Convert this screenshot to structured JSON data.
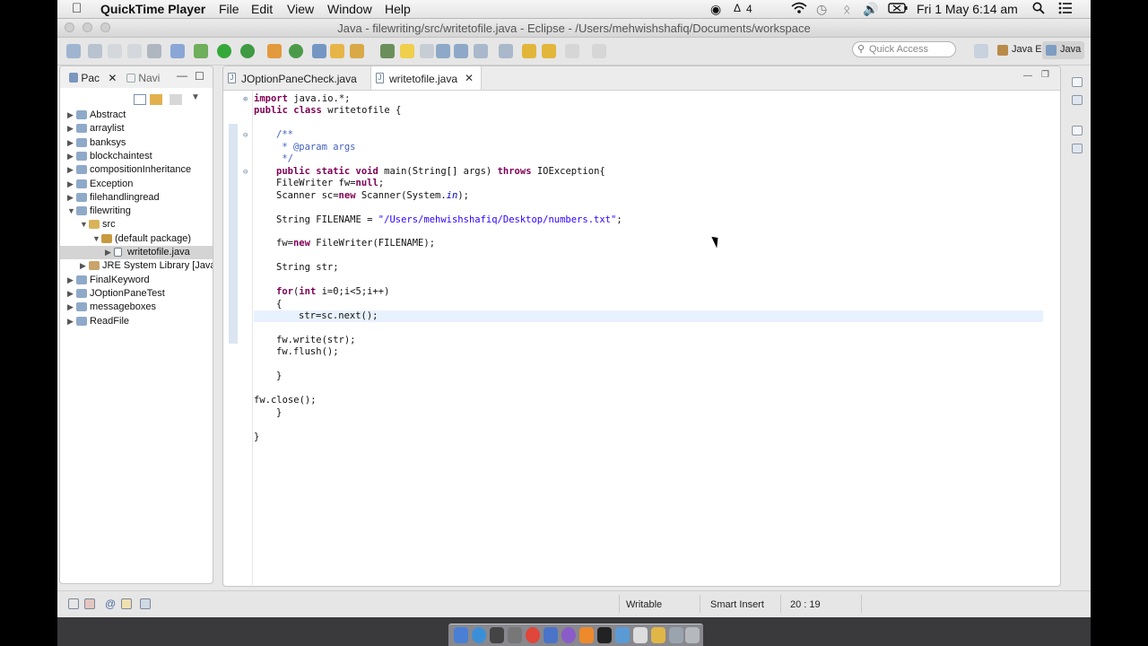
{
  "menubar": {
    "app_name": "QuickTime Player",
    "items": [
      "File",
      "Edit",
      "View",
      "Window",
      "Help"
    ],
    "status_icons": [
      "record-icon",
      "adobe-icon",
      "wifi-icon",
      "time-machine-icon",
      "bluetooth-icon",
      "volume-icon",
      "battery-icon",
      "spotlight-icon",
      "notification-center-icon"
    ],
    "badge": "4",
    "clock": "Fri 1 May  6:14 am"
  },
  "window": {
    "title": "Java - filewriting/src/writetofile.java - Eclipse - /Users/mehwishshafiq/Documents/workspace"
  },
  "toolbar": {
    "quick_access_placeholder": "Quick Access",
    "perspectives": [
      "Java EE",
      "Java"
    ]
  },
  "explorer": {
    "tabs": [
      "Pac",
      "Navi"
    ],
    "items": [
      {
        "label": "Abstract",
        "depth": 0,
        "expanded": false,
        "kind": "project"
      },
      {
        "label": "arraylist",
        "depth": 0,
        "expanded": false,
        "kind": "project"
      },
      {
        "label": "banksys",
        "depth": 0,
        "expanded": false,
        "kind": "project"
      },
      {
        "label": "blockchaintest",
        "depth": 0,
        "expanded": false,
        "kind": "project"
      },
      {
        "label": "compositionInheritance",
        "depth": 0,
        "expanded": false,
        "kind": "project"
      },
      {
        "label": "Exception",
        "depth": 0,
        "expanded": false,
        "kind": "project"
      },
      {
        "label": "filehandlingread",
        "depth": 0,
        "expanded": false,
        "kind": "project"
      },
      {
        "label": "filewriting",
        "depth": 0,
        "expanded": true,
        "kind": "project"
      },
      {
        "label": "src",
        "depth": 1,
        "expanded": true,
        "kind": "src"
      },
      {
        "label": "(default package)",
        "depth": 2,
        "expanded": true,
        "kind": "package"
      },
      {
        "label": "writetofile.java",
        "depth": 3,
        "expanded": false,
        "kind": "java",
        "selected": true
      },
      {
        "label": "JRE System Library [Java",
        "depth": 1,
        "expanded": false,
        "kind": "library"
      },
      {
        "label": "FinalKeyword",
        "depth": 0,
        "expanded": false,
        "kind": "project"
      },
      {
        "label": "JOptionPaneTest",
        "depth": 0,
        "expanded": false,
        "kind": "project"
      },
      {
        "label": "messageboxes",
        "depth": 0,
        "expanded": false,
        "kind": "project"
      },
      {
        "label": "ReadFile",
        "depth": 0,
        "expanded": false,
        "kind": "project"
      }
    ]
  },
  "editor": {
    "tabs": [
      {
        "label": "JOptionPaneCheck.java",
        "active": false
      },
      {
        "label": "writetofile.java",
        "active": true
      }
    ],
    "lines": [
      {
        "indent": 0,
        "parts": [
          [
            "kw",
            "import"
          ],
          [
            "",
            " java.io.*;"
          ]
        ],
        "fold": "plus"
      },
      {
        "indent": 0,
        "parts": [
          [
            "kw",
            "public"
          ],
          [
            "",
            " "
          ],
          [
            "kw",
            "class"
          ],
          [
            "",
            " writetofile {"
          ]
        ]
      },
      {
        "indent": 0,
        "parts": []
      },
      {
        "indent": 1,
        "parts": [
          [
            "cm",
            "/**"
          ]
        ],
        "fold": "minus"
      },
      {
        "indent": 1,
        "parts": [
          [
            "cm",
            " * @param args"
          ]
        ]
      },
      {
        "indent": 1,
        "parts": [
          [
            "cm",
            " */"
          ]
        ]
      },
      {
        "indent": 1,
        "parts": [
          [
            "kw",
            "public"
          ],
          [
            "",
            " "
          ],
          [
            "kw",
            "static"
          ],
          [
            "",
            " "
          ],
          [
            "kw",
            "void"
          ],
          [
            "",
            " main(String[] args) "
          ],
          [
            "kw",
            "throws"
          ],
          [
            "",
            " IOException{"
          ]
        ],
        "fold": "minus"
      },
      {
        "indent": 1,
        "parts": [
          [
            "",
            "FileWriter fw="
          ],
          [
            "kw",
            "null"
          ],
          [
            "",
            ";"
          ]
        ]
      },
      {
        "indent": 1,
        "parts": [
          [
            "",
            "Scanner sc="
          ],
          [
            "kw",
            "new"
          ],
          [
            "",
            " Scanner(System."
          ],
          [
            "it",
            "in"
          ],
          [
            "",
            ");"
          ]
        ]
      },
      {
        "indent": 0,
        "parts": []
      },
      {
        "indent": 1,
        "parts": [
          [
            "",
            "String FILENAME = "
          ],
          [
            "st",
            "\"/Users/mehwishshafiq/Desktop/numbers.txt\""
          ],
          [
            "",
            ";"
          ]
        ]
      },
      {
        "indent": 0,
        "parts": []
      },
      {
        "indent": 1,
        "parts": [
          [
            "",
            "fw="
          ],
          [
            "kw",
            "new"
          ],
          [
            "",
            " FileWriter(FILENAME);"
          ]
        ]
      },
      {
        "indent": 0,
        "parts": []
      },
      {
        "indent": 1,
        "parts": [
          [
            "",
            "String str;"
          ]
        ]
      },
      {
        "indent": 0,
        "parts": []
      },
      {
        "indent": 1,
        "parts": [
          [
            "kw",
            "for"
          ],
          [
            "",
            "("
          ],
          [
            "kw",
            "int"
          ],
          [
            "",
            " i=0;i<5;i++)"
          ]
        ]
      },
      {
        "indent": 1,
        "parts": [
          [
            "",
            "{"
          ]
        ]
      },
      {
        "indent": 1,
        "parts": [
          [
            "",
            "str=sc.next();"
          ]
        ],
        "current": true
      },
      {
        "indent": 0,
        "parts": []
      },
      {
        "indent": 1,
        "parts": [
          [
            "",
            "fw.write(str);"
          ]
        ]
      },
      {
        "indent": 1,
        "parts": [
          [
            "",
            "fw.flush();"
          ]
        ]
      },
      {
        "indent": 0,
        "parts": []
      },
      {
        "indent": 1,
        "parts": [
          [
            "",
            "}"
          ]
        ]
      },
      {
        "indent": 0,
        "parts": []
      },
      {
        "indent": 0,
        "parts": [
          [
            "",
            "fw.close();"
          ]
        ]
      },
      {
        "indent": 1,
        "parts": [
          [
            "",
            "}"
          ]
        ]
      },
      {
        "indent": 0,
        "parts": []
      },
      {
        "indent": 0,
        "parts": [
          [
            "",
            "}"
          ]
        ]
      }
    ]
  },
  "status": {
    "writable": "Writable",
    "insert_mode": "Smart Insert",
    "position": "20 : 19"
  },
  "colors": {
    "keyword": "#7f0055",
    "comment": "#3f5fbf",
    "string": "#2a00ff",
    "static_field": "#0000c0",
    "current_line": "#e8f2fe",
    "selection": "#d4d4d4"
  }
}
